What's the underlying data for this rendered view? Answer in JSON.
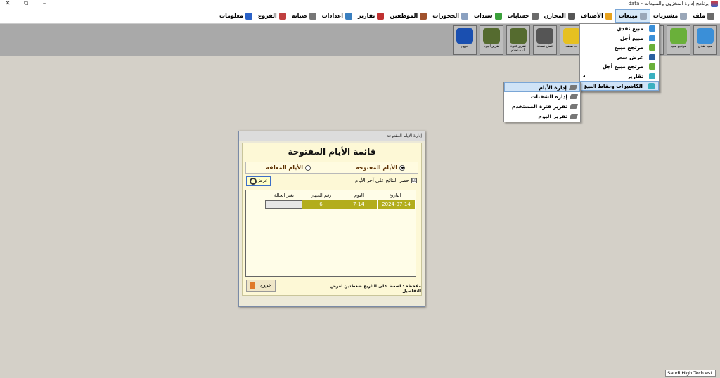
{
  "window": {
    "title": "برنامج إدارة المخزون والمبيعات - data",
    "close": "✕",
    "restore": "⧉",
    "minimize": "–"
  },
  "menubar": [
    {
      "label": "ملف",
      "icon": "file-icon",
      "color": "#6b6b6b"
    },
    {
      "label": "مشتريات",
      "icon": "purchases-icon",
      "color": "#9aa7b8"
    },
    {
      "label": "مبيعات",
      "icon": "sales-icon",
      "color": "#9aa7b8"
    },
    {
      "label": "الأصناف",
      "icon": "items-icon",
      "color": "#e8a21c"
    },
    {
      "label": "المخازن",
      "icon": "stores-icon",
      "color": "#555"
    },
    {
      "label": "حسابات",
      "icon": "accounts-icon",
      "color": "#6b6b6b"
    },
    {
      "label": "سندات",
      "icon": "vouchers-icon",
      "color": "#3aa03a"
    },
    {
      "label": "الحجوزات",
      "icon": "bookings-icon",
      "color": "#8aa0c0"
    },
    {
      "label": "الموظفين",
      "icon": "employees-icon",
      "color": "#a0522d"
    },
    {
      "label": "تقارير",
      "icon": "reports-icon",
      "color": "#c03030"
    },
    {
      "label": "اعدادات",
      "icon": "settings-icon",
      "color": "#3a7fc0"
    },
    {
      "label": "صيانة",
      "icon": "maintenance-icon",
      "color": "#777"
    },
    {
      "label": "الفروع",
      "icon": "branches-icon",
      "color": "#c04040"
    },
    {
      "label": "معلومات",
      "icon": "info-icon",
      "color": "#2a62c8"
    }
  ],
  "toolbar": [
    {
      "label": "مبيع نقدي",
      "color": "#3a8fd8"
    },
    {
      "label": "مرتجع مبيع",
      "color": "#6ab03a"
    },
    {
      "label": "",
      "color": "#e6b020"
    },
    {
      "label": "",
      "color": "#3a8fd8"
    },
    {
      "label": "",
      "color": "#6ab03a"
    },
    {
      "label": "ت صنف",
      "color": "#e6c020"
    },
    {
      "label": "عمل نسخة",
      "color": "#555555"
    },
    {
      "label": "تقرير فترة المستخدم",
      "color": "#556b2f"
    },
    {
      "label": "تقرير اليوم",
      "color": "#556b2f"
    },
    {
      "label": "خروج",
      "color": "#1a4fb0"
    }
  ],
  "dropdown": [
    {
      "label": "مبيع نقدي",
      "color": "#3a8fd8"
    },
    {
      "label": "مبيع أجل",
      "color": "#3a8fd8"
    },
    {
      "label": "مرتجع مبيع",
      "color": "#6ab03a"
    },
    {
      "label": "عرض سعر",
      "color": "#2a5fa0"
    },
    {
      "label": "مرتجع مبيع أجل",
      "color": "#6ab03a"
    },
    {
      "label": "تقارير",
      "color": "#3ab0c0",
      "arrow": "◂"
    },
    {
      "label": "الكاشيرات ونقاط البيع",
      "color": "#3ab0c0",
      "arrow": "◂"
    }
  ],
  "submenu": [
    "إدارة الأيام",
    "إدارة الشفتات",
    "تقرير فترة المستخدم",
    "تقرير اليوم"
  ],
  "dialog": {
    "title": "إدارة الأيام المفتوحة",
    "heading": "قائمة الأيام المفتوحة",
    "radio_open": "الأيام المفتوحه",
    "radio_closed": "الأيام المغلقة",
    "checkbox_label": "حصر النتائج على آخر الأيام",
    "checkbox_mark": "☑",
    "show_button": "عرض",
    "columns": [
      "التاريخ",
      "اليوم",
      "رقم الجهاز",
      "تغير الحالة"
    ],
    "rows": [
      {
        "date": "2024-07-14",
        "day": "7-14",
        "device": "6",
        "status": ""
      }
    ],
    "note": "ملاحظة : اضغط على التاريخ  ضغطتين لعرض التفاصيل",
    "exit_button": "خروج"
  },
  "status": "Saudi High Tech est."
}
